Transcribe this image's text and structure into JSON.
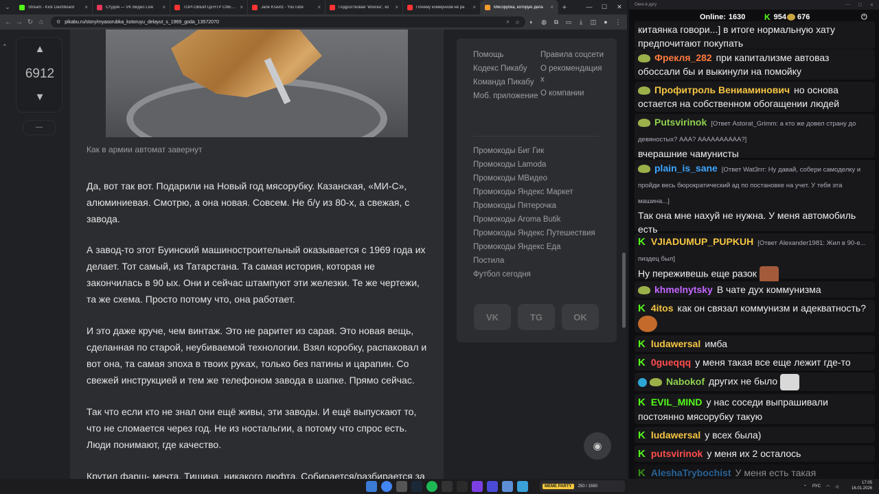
{
  "browser": {
    "tabs": [
      {
        "label": "Stream - Kick Dashboard",
        "color": "#53fc18"
      },
      {
        "label": "Студия — VK Видео Live",
        "color": "#e8375a"
      },
      {
        "label": "ТОРГОВЫЙ ЦЕНТР СМЕРТИ",
        "color": "#ff3333"
      },
      {
        "label": "Jane Kravitz - YouTube",
        "color": "#ff3333"
      },
      {
        "label": "Подростковая \"вписка\", ко",
        "color": "#ff3333"
      },
      {
        "label": "Почему коммунизм не ра",
        "color": "#ff3333"
      },
      {
        "label": "Мясорубка, которую дела",
        "color": "#f59a2d"
      }
    ],
    "url": "pikabu.ru/story/myasorubka_kotoruyu_delayut_s_1969_goda_13572070"
  },
  "post": {
    "rating": "6912",
    "minus_label": "—",
    "caption": "Как в армии автомат завернут",
    "paragraphs": [
      "Да, вот так вот. Подарили на Новый год мясорубку. Казанская, «МИ-С», алюминиевая. Смотрю, а она новая. Совсем. Не б/у из 80-х, а свежая, с завода.",
      "А завод-то этот Буинский машиностроительный оказывается с 1969 года их делает. Тот самый, из Татарстана. Та самая история, которая не закончилась в 90 ых. Они и сейчас штампуют эти железки. Те же чертежи, та же схема. Просто потому что, она работает.",
      "И это даже круче, чем винтаж. Это не раритет из сарая. Это новая вещь, сделанная по старой, неубиваемой технологии. Взял коробку, распаковал и вот она, та самая эпоха в твоих руках, только без патины и царапин. Со свежей инструкцией и тем же телефоном завода в шапке. Прямо сейчас.",
      "Так что если кто не знал они ещё живы, эти заводы. И ещё выпускают то, что не сломается через год. Не из ностальгии, а потому что спрос есть. Люди понимают, где качество.",
      "Крутил фарш- мечта. Тишина, никакого люфта. Собирается/разбирается за"
    ]
  },
  "sidebar": {
    "col1": [
      "Помощь",
      "Кодекс Пикабу",
      "Команда Пикабу",
      "Моб. приложение"
    ],
    "col2": [
      "Правила соцсети",
      "О рекомендация х",
      "О компании"
    ],
    "promo": [
      "Промокоды Биг Гик",
      "Промокоды Lamoda",
      "Промокоды МВидео",
      "Промокоды Яндекс Маркет",
      "Промокоды Пятерочка",
      "Промокоды Aroma Butik",
      "Промокоды Яндекс Путешествия",
      "Промокоды Яндекс Еда",
      "Постила",
      "Футбол сегодня"
    ],
    "social": [
      "VK",
      "TG",
      "OK"
    ]
  },
  "chat": {
    "window_title": "Окно в дугу",
    "online_label": "Online:",
    "online_count": "1630",
    "kick_count": "954",
    "pepe_count": "676",
    "messages": [
      {
        "user": "",
        "text": "китаянка говори...] в итоге нормальную хату предпочитают покупать"
      },
      {
        "user": "Фрекля_282",
        "color": "#ff7a3d",
        "badge": "pepe",
        "text": "при капитализме автоваз обоссали бы и выкинули на помойку"
      },
      {
        "user": "Профитроль Вениаминович",
        "color": "#f5c542",
        "badge": "pepe",
        "text": "но основа остается на собственном обогащении людей"
      },
      {
        "user": "Putsvirinok",
        "color": "#8fd14f",
        "badge": "pepe",
        "reply": "[Ответ Astorat_Grimm: а кто же довел страну до девяностых? ААА? АААААААААА?]",
        "text": "вчерашние чамунисты"
      },
      {
        "user": "plain_is_sane",
        "color": "#3ea6ff",
        "badge": "pepe",
        "reply": "[Ответ Wat3rrr: Ну давай, собери самоделку и пройди весь бюрократический ад по постановке на учет. У тебя эта машина...]",
        "text": "Так она мне нахуй не нужна. У меня автомобиль есть"
      },
      {
        "user": "VJIADUMUP_PUPKUH",
        "color": "#f5c542",
        "badge": "kick",
        "reply": "[Ответ Alexander1981: Жил в 90-е... пиздец был]",
        "text": "Ну переживешь еще разок"
      },
      {
        "user": "khmelnytsky",
        "color": "#c466ff",
        "badge": "pepe",
        "text": "В чате дух коммунизма"
      },
      {
        "user": "4itos",
        "color": "#f5c542",
        "badge": "kick",
        "text": "как он связал коммунизм и адекватность?"
      },
      {
        "user": "ludawersal",
        "color": "#f5c542",
        "badge": "kick",
        "text": "имба"
      },
      {
        "user": "0gueqqq",
        "color": "#ff4d4d",
        "badge": "kick",
        "text": "у меня такая все еще лежит где-то"
      },
      {
        "user": "Nabokof",
        "color": "#8fd14f",
        "badge": "verified",
        "text": "других не было"
      },
      {
        "user": "EVIL_MIND",
        "color": "#53fc18",
        "badge": "kick",
        "text": "у нас соседи выпрашивали постоянно мясорубку такую"
      },
      {
        "user": "ludawersal",
        "color": "#f5c542",
        "badge": "kick",
        "text": "у всех была)"
      },
      {
        "user": "putsvirinok",
        "color": "#ff4d4d",
        "badge": "kick",
        "text": "у меня их 2 осталось"
      },
      {
        "user": "AleshaTrybochist",
        "color": "#3ea6ff",
        "badge": "kick",
        "text": "У меня есть такая"
      }
    ]
  },
  "taskbar": {
    "widget_title": "МЕМЕ PARTY",
    "widget_value": "250 / 1590",
    "lang": "РУС",
    "time": "17:05",
    "date": "16.01.2026"
  }
}
